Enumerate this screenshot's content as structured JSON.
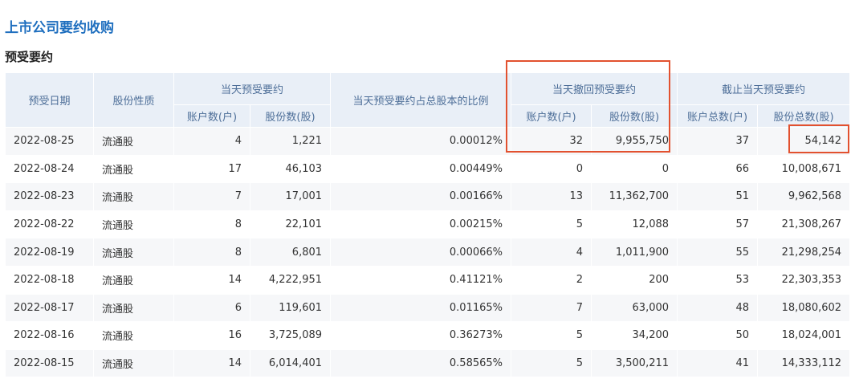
{
  "page": {
    "title": "上市公司要约收购",
    "section_title": "预受要约"
  },
  "table": {
    "headers": {
      "date": "预受日期",
      "share_type": "股份性质",
      "today_accept": "当天预受要约",
      "ratio": "当天预受要约占总股本的比例",
      "today_withdraw": "当天撤回预受要约",
      "cumulative": "截止当天预受要约",
      "accounts": "账户数(户)",
      "shares": "股份数(股)",
      "total_accounts": "账户总数(户)",
      "total_shares": "股份总数(股)"
    },
    "rows": [
      {
        "date": "2022-08-25",
        "type": "流通股",
        "acc": "4",
        "shares": "1,221",
        "ratio": "0.00012%",
        "w_acc": "32",
        "w_shares": "9,955,750",
        "t_acc": "37",
        "t_shares": "54,142"
      },
      {
        "date": "2022-08-24",
        "type": "流通股",
        "acc": "17",
        "shares": "46,103",
        "ratio": "0.00449%",
        "w_acc": "0",
        "w_shares": "0",
        "t_acc": "66",
        "t_shares": "10,008,671"
      },
      {
        "date": "2022-08-23",
        "type": "流通股",
        "acc": "7",
        "shares": "17,001",
        "ratio": "0.00166%",
        "w_acc": "13",
        "w_shares": "11,362,700",
        "t_acc": "51",
        "t_shares": "9,962,568"
      },
      {
        "date": "2022-08-22",
        "type": "流通股",
        "acc": "8",
        "shares": "22,101",
        "ratio": "0.00215%",
        "w_acc": "5",
        "w_shares": "12,088",
        "t_acc": "57",
        "t_shares": "21,308,267"
      },
      {
        "date": "2022-08-19",
        "type": "流通股",
        "acc": "8",
        "shares": "6,801",
        "ratio": "0.00066%",
        "w_acc": "4",
        "w_shares": "1,011,900",
        "t_acc": "55",
        "t_shares": "21,298,254"
      },
      {
        "date": "2022-08-18",
        "type": "流通股",
        "acc": "14",
        "shares": "4,222,951",
        "ratio": "0.41121%",
        "w_acc": "2",
        "w_shares": "200",
        "t_acc": "53",
        "t_shares": "22,303,353"
      },
      {
        "date": "2022-08-17",
        "type": "流通股",
        "acc": "6",
        "shares": "119,601",
        "ratio": "0.01165%",
        "w_acc": "7",
        "w_shares": "63,000",
        "t_acc": "48",
        "t_shares": "18,080,602"
      },
      {
        "date": "2022-08-16",
        "type": "流通股",
        "acc": "16",
        "shares": "3,725,089",
        "ratio": "0.36273%",
        "w_acc": "5",
        "w_shares": "34,200",
        "t_acc": "50",
        "t_shares": "18,024,001"
      },
      {
        "date": "2022-08-15",
        "type": "流通股",
        "acc": "14",
        "shares": "6,014,401",
        "ratio": "0.58565%",
        "w_acc": "5",
        "w_shares": "3,500,211",
        "t_acc": "41",
        "t_shares": "14,333,112"
      }
    ]
  },
  "colors": {
    "title": "#1f6fbf",
    "header_bg": "#e9eff7",
    "header_text": "#4d6e98",
    "highlight": "#e2512f"
  }
}
